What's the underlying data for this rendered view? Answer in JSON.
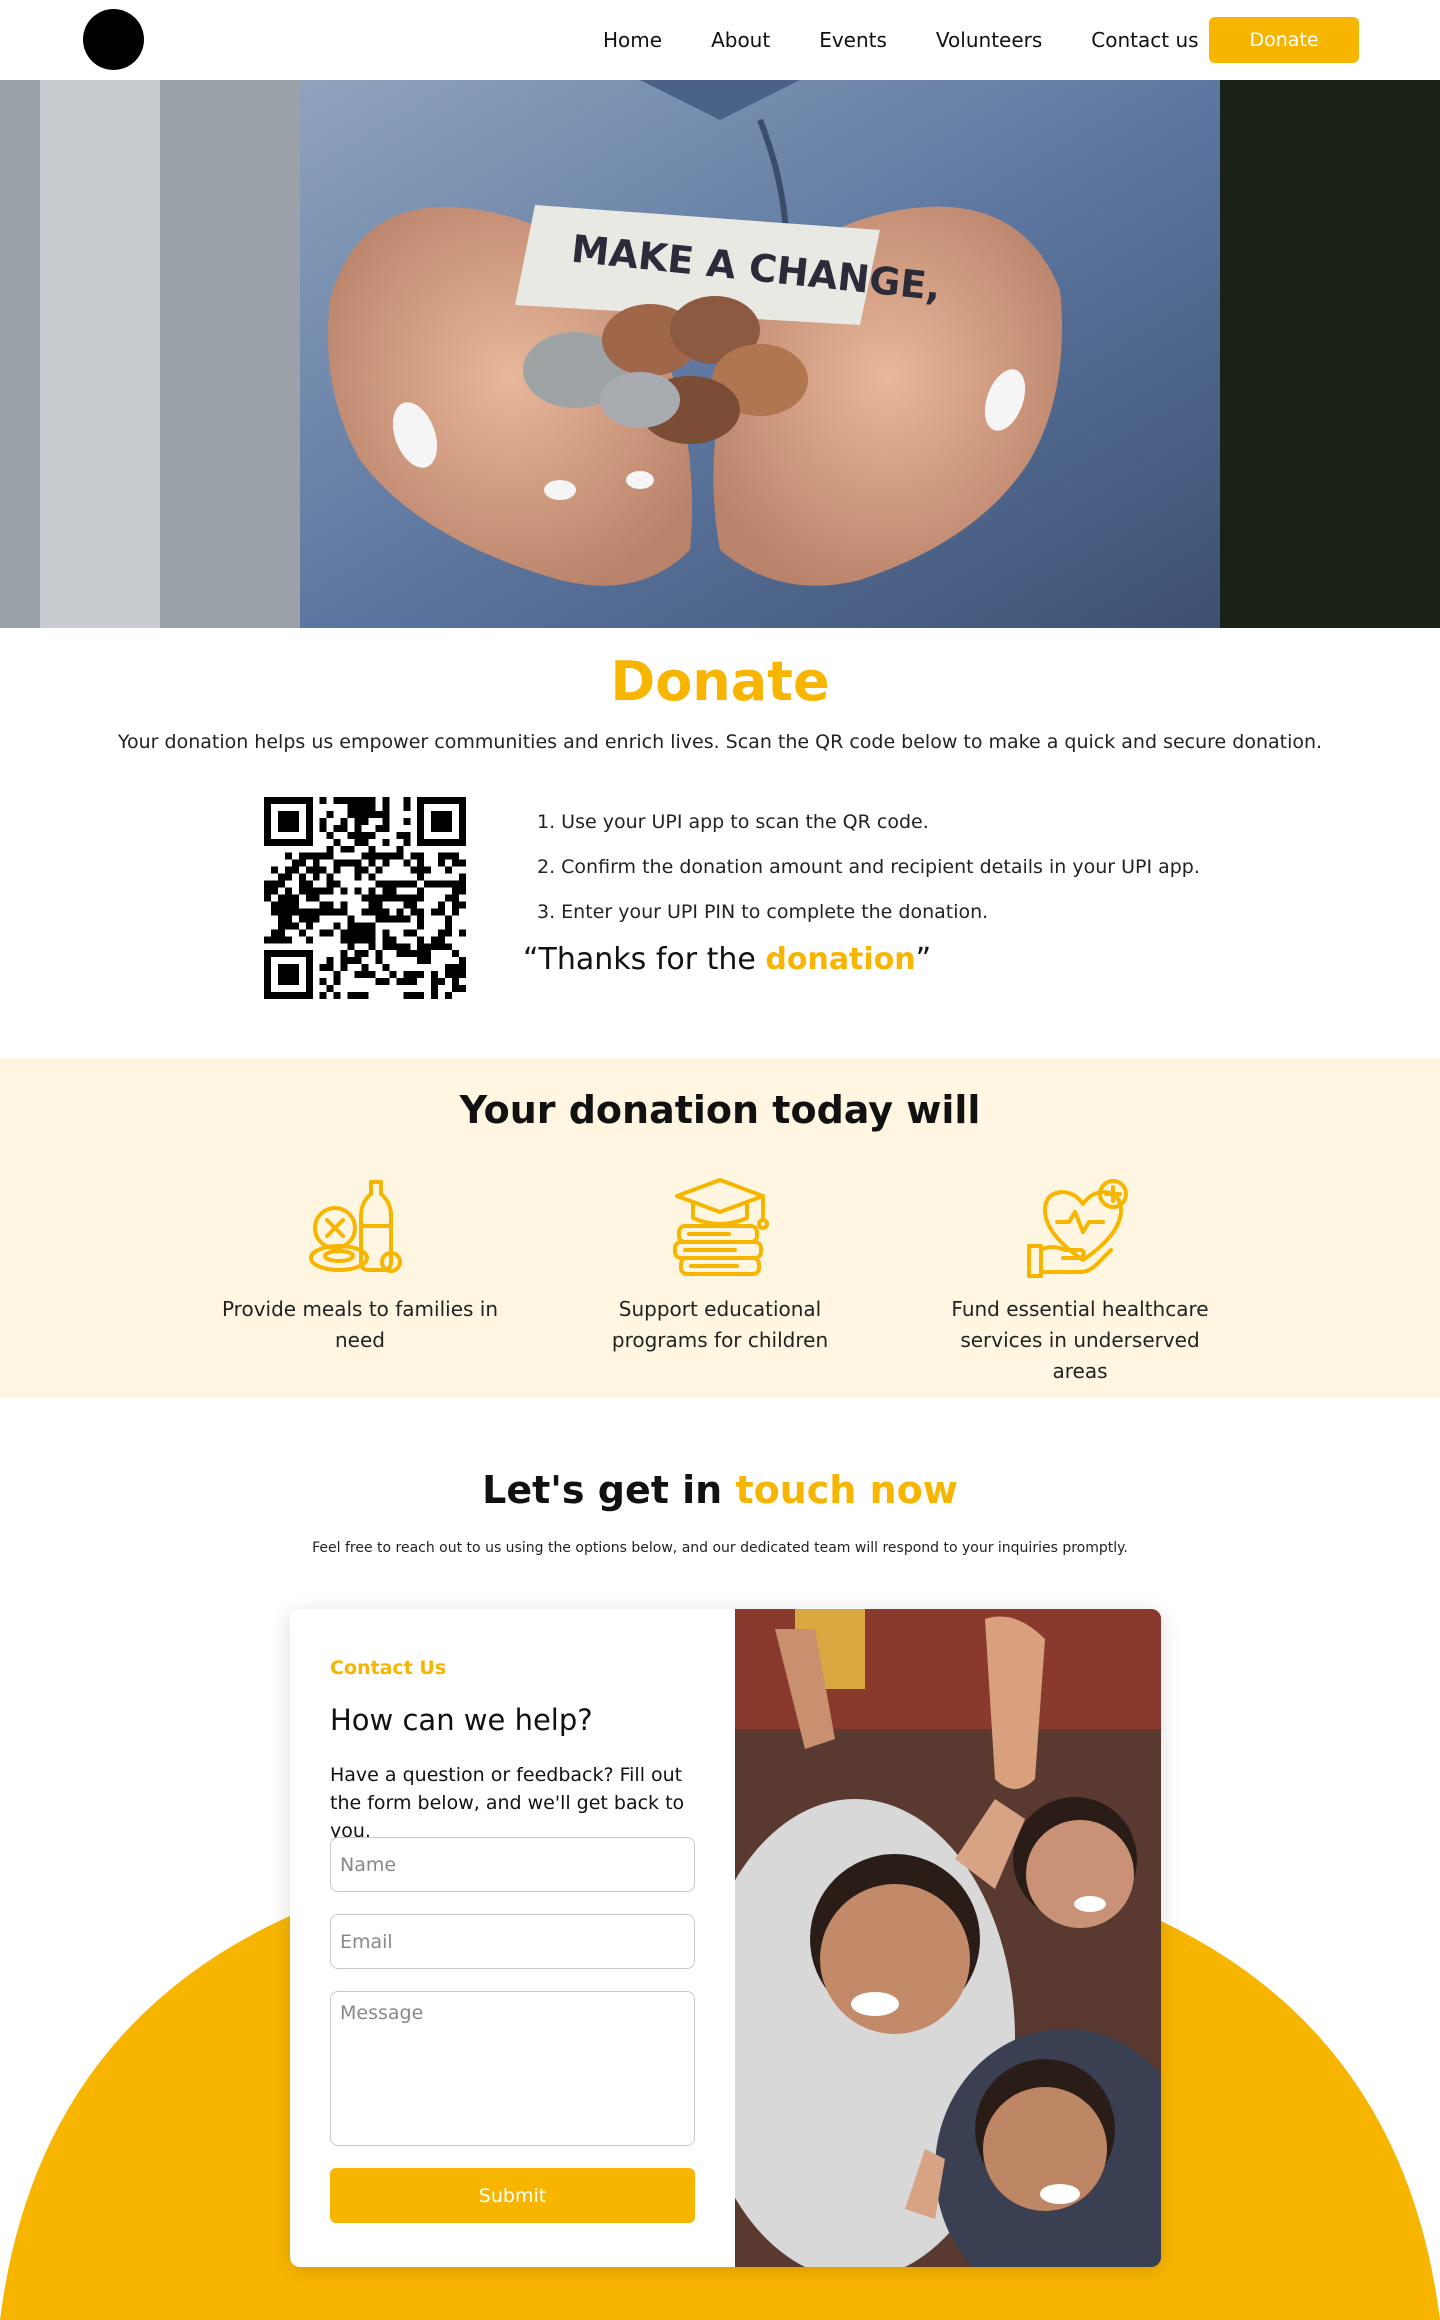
{
  "nav": {
    "links": [
      "Home",
      "About",
      "Events",
      "Volunteers",
      "Contact us"
    ],
    "donate_label": "Donate"
  },
  "hero": {
    "note_text": "MAKE A CHANGE,"
  },
  "donate": {
    "title": "Donate",
    "subtitle": "Your donation helps us empower communities and enrich lives. Scan the QR code below to make a quick and secure donation.",
    "steps": [
      "1. Use your UPI app to scan the QR code.",
      "2. Confirm the donation amount and recipient details in your UPI app.",
      "3. Enter your UPI PIN to complete the donation."
    ],
    "thanks_prefix": "“Thanks for the ",
    "thanks_highlight": "donation",
    "thanks_suffix": "”"
  },
  "impact": {
    "title": "Your donation today will",
    "items": [
      {
        "icon": "food-icon",
        "text": "Provide meals to families in need"
      },
      {
        "icon": "education-icon",
        "text": "Support educational programs for children"
      },
      {
        "icon": "healthcare-icon",
        "text": "Fund essential healthcare services in underserved areas"
      }
    ]
  },
  "contact": {
    "title_prefix": "Let's get in ",
    "title_highlight": "touch now",
    "subtitle": "Feel free to reach out to us using the options below, and our dedicated team will respond to your inquiries promptly.",
    "eyebrow": "Contact Us",
    "heading": "How can we help?",
    "description": "Have a question or feedback? Fill out the form below, and we'll get back to you.",
    "name_placeholder": "Name",
    "email_placeholder": "Email",
    "message_placeholder": "Message",
    "submit_label": "Submit"
  },
  "colors": {
    "accent": "#F8B500",
    "impact_bg": "#FEF6E0"
  }
}
